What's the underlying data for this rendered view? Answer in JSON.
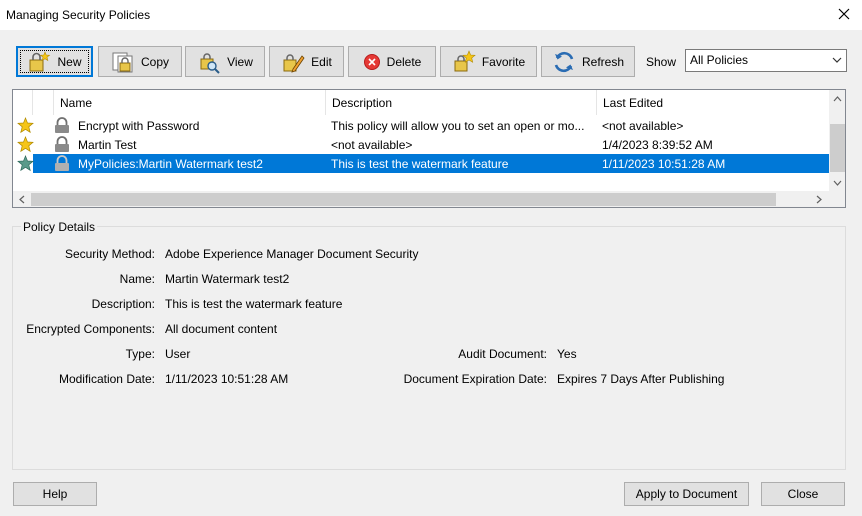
{
  "window": {
    "title": "Managing Security Policies"
  },
  "toolbar": {
    "new_label": "New",
    "copy_label": "Copy",
    "view_label": "View",
    "edit_label": "Edit",
    "delete_label": "Delete",
    "favorite_label": "Favorite",
    "refresh_label": "Refresh",
    "show_label": "Show",
    "show_value": "All Policies"
  },
  "list": {
    "columns": [
      "Name",
      "Description",
      "Last Edited"
    ],
    "rows": [
      {
        "name": "Encrypt with Password",
        "description": "This policy will allow you to set an open or mo...",
        "last_edited": "<not available>",
        "favorite": true,
        "selected": false
      },
      {
        "name": "Martin Test",
        "description": "<not available>",
        "last_edited": "1/4/2023 8:39:52 AM",
        "favorite": true,
        "selected": false
      },
      {
        "name": "MyPolicies:Martin Watermark test2",
        "description": "This is test the watermark feature",
        "last_edited": "1/11/2023 10:51:28 AM",
        "favorite": true,
        "selected": true
      }
    ]
  },
  "details": {
    "group_title": "Policy Details",
    "security_method_label": "Security Method:",
    "security_method": "Adobe Experience Manager Document Security",
    "name_label": "Name:",
    "name": "Martin Watermark test2",
    "description_label": "Description:",
    "description": "This is test the watermark feature",
    "encrypted_label": "Encrypted Components:",
    "encrypted": "All document content",
    "type_label": "Type:",
    "type": "User",
    "modification_label": "Modification Date:",
    "modification": "1/11/2023 10:51:28 AM",
    "audit_label": "Audit Document:",
    "audit": "Yes",
    "expiration_label": "Document Expiration Date:",
    "expiration": "Expires 7 Days After Publishing"
  },
  "footer": {
    "help_label": "Help",
    "apply_label": "Apply to Document",
    "close_label": "Close"
  },
  "colors": {
    "selection": "#0078d7",
    "star_gold": "#f5c518",
    "star_selected": "#5a9a8a"
  }
}
